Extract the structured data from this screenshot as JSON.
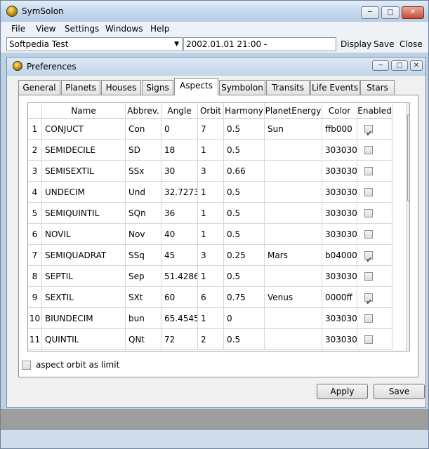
{
  "window": {
    "title": "SymSolon"
  },
  "menu": [
    "File",
    "View",
    "Settings",
    "Windows",
    "Help"
  ],
  "toolbar": {
    "chart_select": "Softpedia Test",
    "datetime": "2002.01.01 21:00 -",
    "display_label": "Display",
    "save_label": "Save",
    "close_label": "Close"
  },
  "preferences": {
    "title": "Preferences",
    "tabs": [
      "General",
      "Planets",
      "Houses",
      "Signs",
      "Aspects",
      "Symbolon",
      "Transits",
      "Life Events",
      "Stars"
    ],
    "active_tab": "Aspects",
    "columns": [
      "Name",
      "Abbrev.",
      "Angle",
      "Orbit",
      "Harmony",
      "PlanetEnergy",
      "Color",
      "Enabled"
    ],
    "rows": [
      {
        "num": "1",
        "name": "CONJUCT",
        "abbrev": "Con",
        "angle": "0",
        "orbit": "7",
        "harmony": "0.5",
        "energy": "Sun",
        "color": "ffb000",
        "enabled": true
      },
      {
        "num": "2",
        "name": "SEMIDECILE",
        "abbrev": "SD",
        "angle": "18",
        "orbit": "1",
        "harmony": "0.5",
        "energy": "",
        "color": "303030",
        "enabled": false
      },
      {
        "num": "3",
        "name": "SEMISEXTIL",
        "abbrev": "SSx",
        "angle": "30",
        "orbit": "3",
        "harmony": "0.66",
        "energy": "",
        "color": "303030",
        "enabled": false
      },
      {
        "num": "4",
        "name": "UNDECIM",
        "abbrev": "Und",
        "angle": "32.7273",
        "orbit": "1",
        "harmony": "0.5",
        "energy": "",
        "color": "303030",
        "enabled": false
      },
      {
        "num": "5",
        "name": "SEMIQUINTIL",
        "abbrev": "SQn",
        "angle": "36",
        "orbit": "1",
        "harmony": "0.5",
        "energy": "",
        "color": "303030",
        "enabled": false
      },
      {
        "num": "6",
        "name": "NOVIL",
        "abbrev": "Nov",
        "angle": "40",
        "orbit": "1",
        "harmony": "0.5",
        "energy": "",
        "color": "303030",
        "enabled": false
      },
      {
        "num": "7",
        "name": "SEMIQUADRAT",
        "abbrev": "SSq",
        "angle": "45",
        "orbit": "3",
        "harmony": "0.25",
        "energy": "Mars",
        "color": "b04000",
        "enabled": true
      },
      {
        "num": "8",
        "name": "SEPTIL",
        "abbrev": "Sep",
        "angle": "51.4286",
        "orbit": "1",
        "harmony": "0.5",
        "energy": "",
        "color": "303030",
        "enabled": false
      },
      {
        "num": "9",
        "name": "SEXTIL",
        "abbrev": "SXt",
        "angle": "60",
        "orbit": "6",
        "harmony": "0.75",
        "energy": "Venus",
        "color": "0000ff",
        "enabled": true
      },
      {
        "num": "10",
        "name": "BIUNDECIM",
        "abbrev": "bun",
        "angle": "65.4545",
        "orbit": "1",
        "harmony": "0",
        "energy": "",
        "color": "303030",
        "enabled": false
      },
      {
        "num": "11",
        "name": "QUINTIL",
        "abbrev": "QNt",
        "angle": "72",
        "orbit": "2",
        "harmony": "0.5",
        "energy": "",
        "color": "303030",
        "enabled": false
      }
    ],
    "aspect_orbit_label": "aspect orbit as limit",
    "aspect_orbit_checked": false,
    "apply_label": "Apply",
    "save_label": "Save"
  },
  "icons": {
    "window_controls": [
      "minimize-icon",
      "maximize-icon",
      "close-icon"
    ],
    "app": "symsolon-logo-icon",
    "scroll": [
      "scroll-up-arrow-icon",
      "scroll-down-arrow-icon"
    ]
  }
}
